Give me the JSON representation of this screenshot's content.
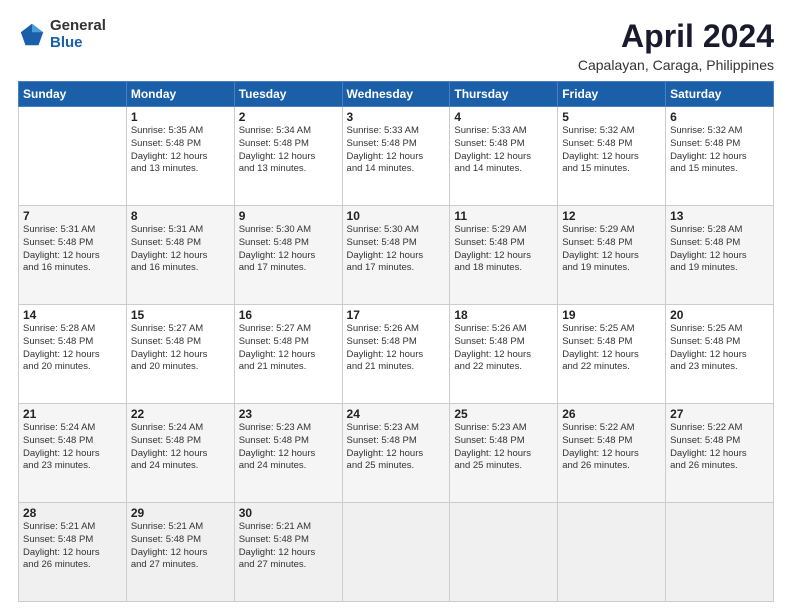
{
  "header": {
    "logo_general": "General",
    "logo_blue": "Blue",
    "main_title": "April 2024",
    "subtitle": "Capalayan, Caraga, Philippines"
  },
  "days_of_week": [
    "Sunday",
    "Monday",
    "Tuesday",
    "Wednesday",
    "Thursday",
    "Friday",
    "Saturday"
  ],
  "weeks": [
    [
      {
        "day": "",
        "info": ""
      },
      {
        "day": "1",
        "info": "Sunrise: 5:35 AM\nSunset: 5:48 PM\nDaylight: 12 hours\nand 13 minutes."
      },
      {
        "day": "2",
        "info": "Sunrise: 5:34 AM\nSunset: 5:48 PM\nDaylight: 12 hours\nand 13 minutes."
      },
      {
        "day": "3",
        "info": "Sunrise: 5:33 AM\nSunset: 5:48 PM\nDaylight: 12 hours\nand 14 minutes."
      },
      {
        "day": "4",
        "info": "Sunrise: 5:33 AM\nSunset: 5:48 PM\nDaylight: 12 hours\nand 14 minutes."
      },
      {
        "day": "5",
        "info": "Sunrise: 5:32 AM\nSunset: 5:48 PM\nDaylight: 12 hours\nand 15 minutes."
      },
      {
        "day": "6",
        "info": "Sunrise: 5:32 AM\nSunset: 5:48 PM\nDaylight: 12 hours\nand 15 minutes."
      }
    ],
    [
      {
        "day": "7",
        "info": "Sunrise: 5:31 AM\nSunset: 5:48 PM\nDaylight: 12 hours\nand 16 minutes."
      },
      {
        "day": "8",
        "info": "Sunrise: 5:31 AM\nSunset: 5:48 PM\nDaylight: 12 hours\nand 16 minutes."
      },
      {
        "day": "9",
        "info": "Sunrise: 5:30 AM\nSunset: 5:48 PM\nDaylight: 12 hours\nand 17 minutes."
      },
      {
        "day": "10",
        "info": "Sunrise: 5:30 AM\nSunset: 5:48 PM\nDaylight: 12 hours\nand 17 minutes."
      },
      {
        "day": "11",
        "info": "Sunrise: 5:29 AM\nSunset: 5:48 PM\nDaylight: 12 hours\nand 18 minutes."
      },
      {
        "day": "12",
        "info": "Sunrise: 5:29 AM\nSunset: 5:48 PM\nDaylight: 12 hours\nand 19 minutes."
      },
      {
        "day": "13",
        "info": "Sunrise: 5:28 AM\nSunset: 5:48 PM\nDaylight: 12 hours\nand 19 minutes."
      }
    ],
    [
      {
        "day": "14",
        "info": "Sunrise: 5:28 AM\nSunset: 5:48 PM\nDaylight: 12 hours\nand 20 minutes."
      },
      {
        "day": "15",
        "info": "Sunrise: 5:27 AM\nSunset: 5:48 PM\nDaylight: 12 hours\nand 20 minutes."
      },
      {
        "day": "16",
        "info": "Sunrise: 5:27 AM\nSunset: 5:48 PM\nDaylight: 12 hours\nand 21 minutes."
      },
      {
        "day": "17",
        "info": "Sunrise: 5:26 AM\nSunset: 5:48 PM\nDaylight: 12 hours\nand 21 minutes."
      },
      {
        "day": "18",
        "info": "Sunrise: 5:26 AM\nSunset: 5:48 PM\nDaylight: 12 hours\nand 22 minutes."
      },
      {
        "day": "19",
        "info": "Sunrise: 5:25 AM\nSunset: 5:48 PM\nDaylight: 12 hours\nand 22 minutes."
      },
      {
        "day": "20",
        "info": "Sunrise: 5:25 AM\nSunset: 5:48 PM\nDaylight: 12 hours\nand 23 minutes."
      }
    ],
    [
      {
        "day": "21",
        "info": "Sunrise: 5:24 AM\nSunset: 5:48 PM\nDaylight: 12 hours\nand 23 minutes."
      },
      {
        "day": "22",
        "info": "Sunrise: 5:24 AM\nSunset: 5:48 PM\nDaylight: 12 hours\nand 24 minutes."
      },
      {
        "day": "23",
        "info": "Sunrise: 5:23 AM\nSunset: 5:48 PM\nDaylight: 12 hours\nand 24 minutes."
      },
      {
        "day": "24",
        "info": "Sunrise: 5:23 AM\nSunset: 5:48 PM\nDaylight: 12 hours\nand 25 minutes."
      },
      {
        "day": "25",
        "info": "Sunrise: 5:23 AM\nSunset: 5:48 PM\nDaylight: 12 hours\nand 25 minutes."
      },
      {
        "day": "26",
        "info": "Sunrise: 5:22 AM\nSunset: 5:48 PM\nDaylight: 12 hours\nand 26 minutes."
      },
      {
        "day": "27",
        "info": "Sunrise: 5:22 AM\nSunset: 5:48 PM\nDaylight: 12 hours\nand 26 minutes."
      }
    ],
    [
      {
        "day": "28",
        "info": "Sunrise: 5:21 AM\nSunset: 5:48 PM\nDaylight: 12 hours\nand 26 minutes."
      },
      {
        "day": "29",
        "info": "Sunrise: 5:21 AM\nSunset: 5:48 PM\nDaylight: 12 hours\nand 27 minutes."
      },
      {
        "day": "30",
        "info": "Sunrise: 5:21 AM\nSunset: 5:48 PM\nDaylight: 12 hours\nand 27 minutes."
      },
      {
        "day": "",
        "info": ""
      },
      {
        "day": "",
        "info": ""
      },
      {
        "day": "",
        "info": ""
      },
      {
        "day": "",
        "info": ""
      }
    ]
  ]
}
